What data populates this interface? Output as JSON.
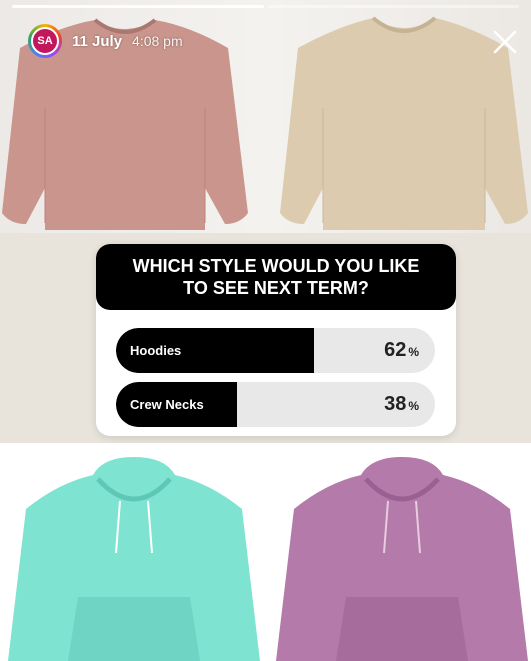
{
  "story": {
    "progress_segments": 2,
    "progress_active_index": 0,
    "account_initials": "SA",
    "date": "11 July",
    "time": "4:08 pm"
  },
  "poll": {
    "question": "WHICH STYLE WOULD YOU LIKE TO SEE NEXT TERM?",
    "options": [
      {
        "label": "Hoodies",
        "percent": 62,
        "percent_sign": "%"
      },
      {
        "label": "Crew Necks",
        "percent": 38,
        "percent_sign": "%"
      }
    ]
  },
  "products": [
    {
      "type": "crew-neck-sweatshirt",
      "color": "#c9958c"
    },
    {
      "type": "crew-neck-sweatshirt",
      "color": "#dccbaf"
    },
    {
      "type": "hoodie",
      "color": "#7fe3d2"
    },
    {
      "type": "hoodie",
      "color": "#b47aaa"
    }
  ],
  "colors": {
    "poll_header_bg": "#000000",
    "bar_fill": "#000000",
    "bar_track": "#e8e8e8"
  },
  "icons": {
    "close": "close-icon",
    "avatar": "profile-avatar"
  }
}
